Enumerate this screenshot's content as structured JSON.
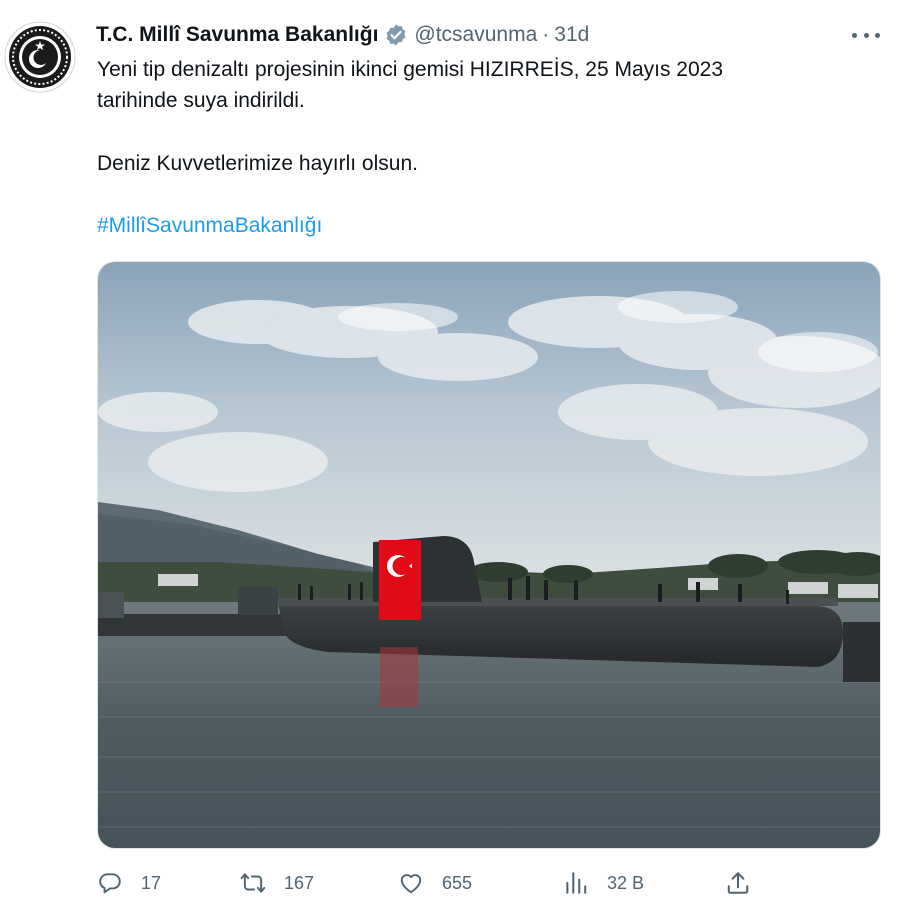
{
  "tweet": {
    "author_name": "T.C. Millî Savunma Bakanlığı",
    "handle": "@tcsavunma",
    "separator": "·",
    "time": "31d",
    "text_line1": "Yeni tip denizaltı projesinin ikinci gemisi HIZIRREİS, 25 Mayıs 2023",
    "text_line2": "tarihinde suya indirildi.",
    "text_line3": "Deniz Kuvvetlerimize hayırlı olsun.",
    "hashtag": "#MillîSavunmaBakanlığı"
  },
  "icons": {
    "avatar": "ministry-emblem",
    "verified": "verified-badge-icon",
    "more": "more-options-icon",
    "reply": "reply-icon",
    "retweet": "retweet-icon",
    "like": "heart-icon",
    "views": "views-chart-icon",
    "share": "share-icon"
  },
  "metrics": {
    "replies": "17",
    "retweets": "167",
    "likes": "655",
    "views": "32 B"
  },
  "colors": {
    "text": "#0f1419",
    "secondary": "#536471",
    "link": "#1d9bf0",
    "flag": "#e30a17"
  }
}
